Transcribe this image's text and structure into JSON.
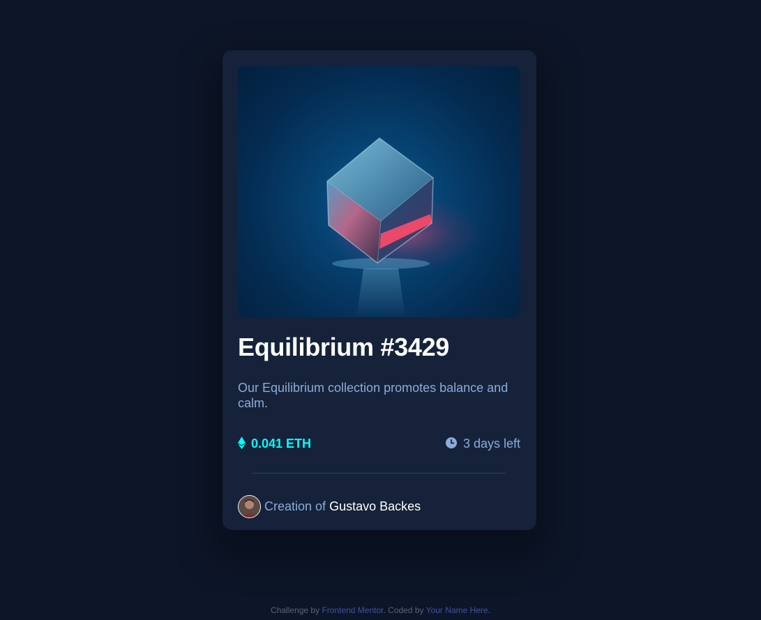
{
  "card": {
    "image_alt": "Equilibrium",
    "title": "Equilibrium #3429",
    "description": "Our Equilibrium collection promotes balance and calm.",
    "price": "0.041 ETH",
    "time_left": "3 days left",
    "creator_prefix": "Creation of",
    "creator_name": "Gustavo Backes"
  },
  "footer": {
    "prefix": "Challenge by",
    "mentor_link": "Frontend Mentor",
    "middle": ". Coded by",
    "author_link": "Your Name Here",
    "suffix": "."
  },
  "icons": {
    "price": "ethereum-icon",
    "time": "clock-icon"
  },
  "colors": {
    "background": "#0d1628",
    "card": "#15223a",
    "cyan": "#00fff8",
    "soft_blue": "#8bacd9",
    "white": "#ffffff"
  }
}
